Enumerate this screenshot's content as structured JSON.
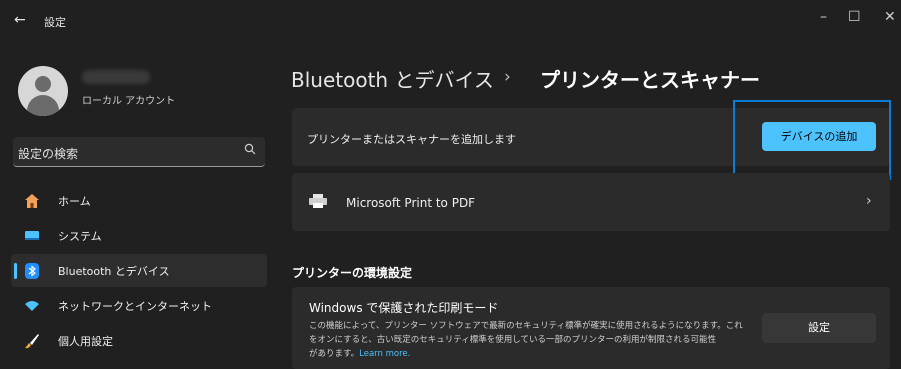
{
  "window": {
    "back_glyph": "←",
    "title": "設定",
    "controls": {
      "minimize": "–",
      "maximize": "☐",
      "close": "✕"
    }
  },
  "account": {
    "type": "ローカル アカウント"
  },
  "search": {
    "placeholder": "設定の検索",
    "icon": "search-icon"
  },
  "sidebar": {
    "items": [
      {
        "label": "ホーム",
        "icon": "home-icon",
        "color": "#f3a25b"
      },
      {
        "label": "システム",
        "icon": "monitor-icon",
        "color": "#4cc2ff"
      },
      {
        "label": "Bluetooth とデバイス",
        "icon": "bluetooth-icon",
        "color": "#1f8fff",
        "selected": true
      },
      {
        "label": "ネットワークとインターネット",
        "icon": "wifi-icon",
        "color": "#4cc2ff"
      },
      {
        "label": "個人用設定",
        "icon": "brush-icon",
        "color": "#f7a23b"
      }
    ]
  },
  "breadcrumb": {
    "parent": "Bluetooth とデバイス",
    "separator": "›",
    "current": "プリンターとスキャナー"
  },
  "add_device": {
    "label": "プリンターまたはスキャナーを追加します",
    "button": "デバイスの追加"
  },
  "printer": {
    "name": "Microsoft Print to PDF",
    "icon": "printer-icon",
    "chevron": "›"
  },
  "section": {
    "title": "プリンターの環境設定"
  },
  "protected_mode": {
    "title": "Windows で保護された印刷モード",
    "desc_line1": "この機能によって、プリンター ソフトウェアで最新のセキュリティ標準が確実に使用されるようになります。これ",
    "desc_line2": "をオンにすると、古い既定のセキュリティ標準を使用している一部のプリンターの利用が制限される可能性",
    "desc_line3": "があります。",
    "learn_more": "Learn more.",
    "button": "設定"
  },
  "colors": {
    "accent": "#4cc2ff",
    "highlight_border": "#0a7cd6",
    "background": "#202020",
    "card": "#2b2b2b"
  }
}
